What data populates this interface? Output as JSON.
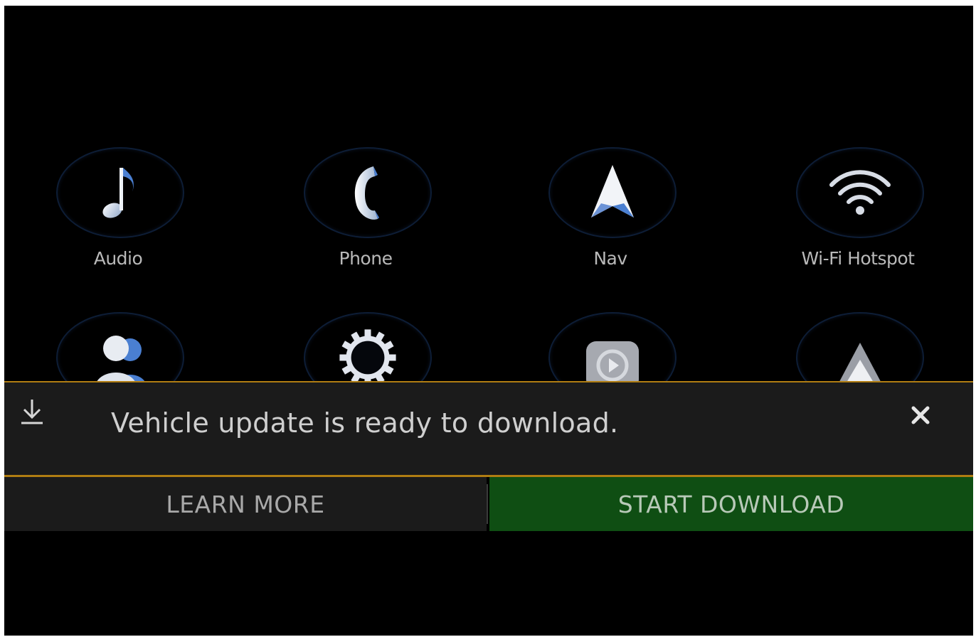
{
  "apps_row1": [
    {
      "label": "Audio",
      "icon": "music-note-icon"
    },
    {
      "label": "Phone",
      "icon": "phone-handset-icon"
    },
    {
      "label": "Nav",
      "icon": "navigation-arrow-icon"
    },
    {
      "label": "Wi-Fi Hotspot",
      "icon": "wifi-icon"
    }
  ],
  "apps_row2": [
    {
      "label": "",
      "icon": "users-icon"
    },
    {
      "label": "",
      "icon": "gear-icon"
    },
    {
      "label": "",
      "icon": "media-play-icon"
    },
    {
      "label": "",
      "icon": "navigation-arrow-icon"
    }
  ],
  "notification": {
    "icon": "download-icon",
    "message": "Vehicle update is ready to download.",
    "close_icon": "close-icon",
    "accent_color": "#b07d12"
  },
  "actions": {
    "learn_more": "LEARN MORE",
    "start_download": "START DOWNLOAD",
    "start_download_color": "#0f4e13"
  }
}
